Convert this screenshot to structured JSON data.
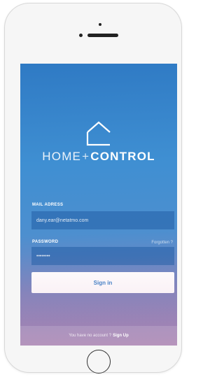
{
  "app": {
    "logo_icon": "house-outline-icon",
    "brand_thin": "HOME",
    "brand_plus": "+",
    "brand_bold": "CONTROL"
  },
  "form": {
    "email_label": "MAIL ADRESS",
    "email_value": "dany.ear@netatmo.com",
    "password_label": "PASSWORD",
    "password_value": "••••••••",
    "forgot_link": "Forgotten ?",
    "signin_label": "Sign in"
  },
  "footer": {
    "prompt": "You have no account ?",
    "signup_link": "Sign Up"
  },
  "colors": {
    "gradient_top": "#2f7ac4",
    "gradient_bottom": "#9d83b4",
    "button_text": "#3d82c8"
  }
}
